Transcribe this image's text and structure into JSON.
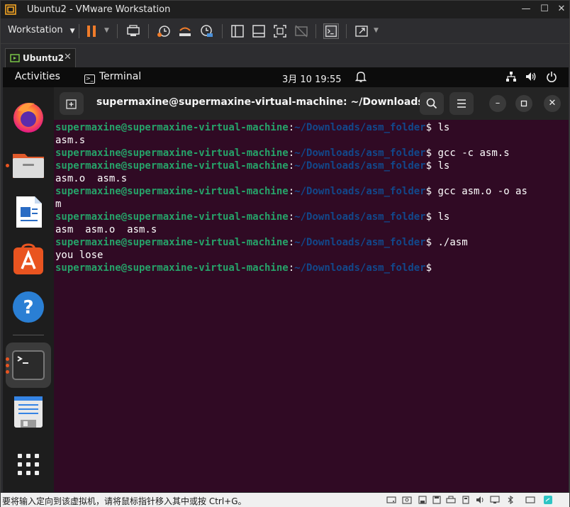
{
  "window": {
    "title": "Ubuntu2 - VMware Workstation"
  },
  "toolbar": {
    "menu_label": "Workstation",
    "icons": [
      "pause-icon",
      "send-keys-icon",
      "snapshot-icon",
      "revert-snapshot-icon",
      "snapshot-manager-icon",
      "sidebar-icon",
      "thumbnail-icon",
      "fullscreen-icon",
      "unity-icon",
      "console-icon",
      "stretch-icon"
    ]
  },
  "vm_tab": {
    "label": "Ubuntu2"
  },
  "ubuntu_topbar": {
    "activities": "Activities",
    "app_name": "Terminal",
    "clock": "3月 10  19:55"
  },
  "dock": {
    "apps": [
      "firefox",
      "files",
      "libreoffice-writer",
      "app-center",
      "help",
      "terminal",
      "text-editor",
      "show-apps"
    ]
  },
  "terminal": {
    "title": "supermaxine@supermaxine-virtual-machine: ~/Downloads/...",
    "prompt_user": "supermaxine@supermaxine-virtual-machine",
    "prompt_colon": ":",
    "prompt_path": "~/Downloads/asm_folder",
    "prompt_sign": "$",
    "lines": [
      {
        "type": "prompt",
        "cmd": " ls"
      },
      {
        "type": "out",
        "text": "asm.s"
      },
      {
        "type": "prompt",
        "cmd": " gcc -c asm.s"
      },
      {
        "type": "prompt",
        "cmd": " ls"
      },
      {
        "type": "out",
        "text": "asm.o  asm.s"
      },
      {
        "type": "prompt",
        "cmd": " gcc asm.o -o as"
      },
      {
        "type": "out",
        "text": "m"
      },
      {
        "type": "prompt",
        "cmd": " ls"
      },
      {
        "type": "out-ls",
        "text": "asm  asm.o  asm.s"
      },
      {
        "type": "prompt",
        "cmd": " ./asm"
      },
      {
        "type": "out",
        "text": "you lose"
      },
      {
        "type": "prompt",
        "cmd": ""
      }
    ]
  },
  "statusbar": {
    "message": "要将输入定向到该虚拟机，请将鼠标指针移入其中或按 Ctrl+G。"
  },
  "colors": {
    "terminal_bg": "#300a24",
    "prompt_user": "#26a269",
    "prompt_path": "#12488b",
    "accent": "#e95420"
  }
}
